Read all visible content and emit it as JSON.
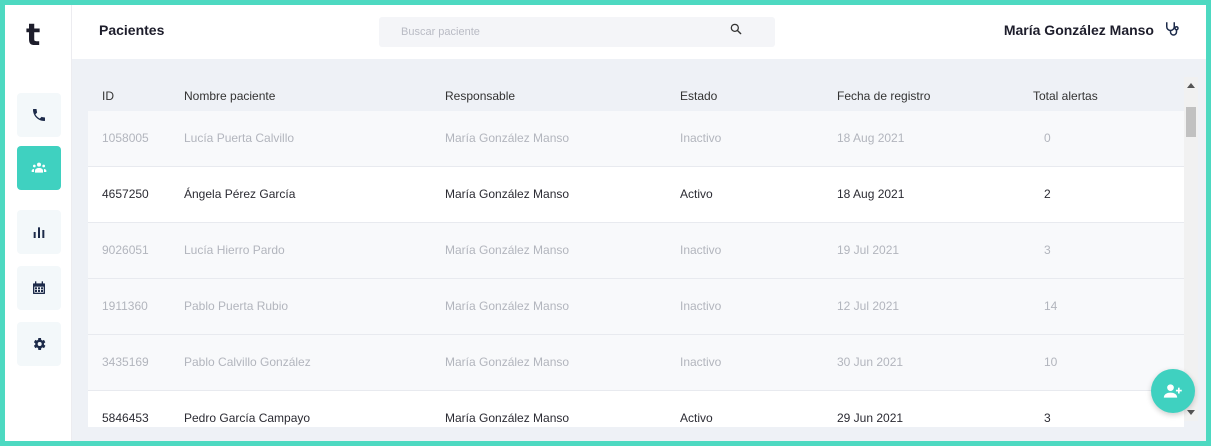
{
  "sidebar": {
    "logo": "t",
    "items": [
      {
        "name": "phone-icon",
        "active": false
      },
      {
        "name": "patients-icon",
        "active": true
      },
      {
        "name": "stats-icon",
        "active": false
      },
      {
        "name": "calendar-icon",
        "active": false
      },
      {
        "name": "gear-icon",
        "active": false
      }
    ]
  },
  "header": {
    "title": "Pacientes",
    "search_placeholder": "Buscar paciente",
    "user_name": "María González Manso"
  },
  "table": {
    "columns": [
      "ID",
      "Nombre paciente",
      "Responsable",
      "Estado",
      "Fecha de registro",
      "Total alertas"
    ],
    "rows": [
      {
        "id": "1058005",
        "name": "Lucía Puerta Calvillo",
        "responsable": "María González Manso",
        "estado": "Inactivo",
        "fecha": "18 Aug 2021",
        "alertas": "0"
      },
      {
        "id": "4657250",
        "name": "Ángela Pérez García",
        "responsable": "María González Manso",
        "estado": "Activo",
        "fecha": "18 Aug 2021",
        "alertas": "2"
      },
      {
        "id": "9026051",
        "name": "Lucía Hierro Pardo",
        "responsable": "María González Manso",
        "estado": "Inactivo",
        "fecha": "19 Jul 2021",
        "alertas": "3"
      },
      {
        "id": "1911360",
        "name": "Pablo Puerta Rubio",
        "responsable": "María González Manso",
        "estado": "Inactivo",
        "fecha": "12 Jul 2021",
        "alertas": "14"
      },
      {
        "id": "3435169",
        "name": "Pablo Calvillo González",
        "responsable": "María González Manso",
        "estado": "Inactivo",
        "fecha": "30 Jun 2021",
        "alertas": "10"
      },
      {
        "id": "5846453",
        "name": "Pedro García Campayo",
        "responsable": "María González Manso",
        "estado": "Activo",
        "fecha": "29 Jun 2021",
        "alertas": "3"
      }
    ]
  },
  "colors": {
    "accent": "#3fd1c0",
    "frame": "#4dd9c1",
    "inactive_text": "#b2b5bd",
    "active_text": "#2b2b33"
  },
  "fab": {
    "icon": "add-user-icon"
  }
}
